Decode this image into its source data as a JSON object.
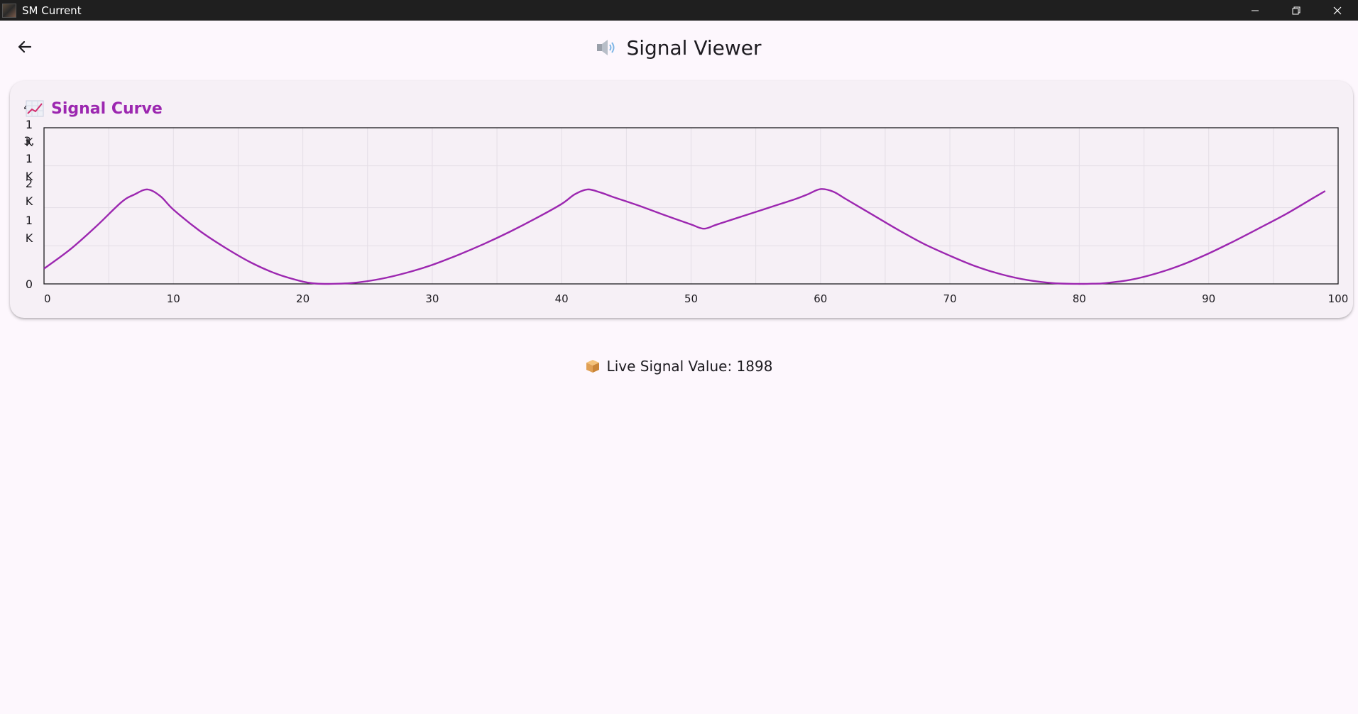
{
  "window": {
    "title": "SM Current",
    "controls": {
      "minimize": "—",
      "restore": "❐",
      "close": "✕"
    }
  },
  "appbar": {
    "back_icon": "arrow-left-icon",
    "title_icon": "speaker-icon",
    "title": "Signal Viewer"
  },
  "card": {
    "icon": "chart-increasing-icon",
    "title": "Signal Curve"
  },
  "live": {
    "icon": "package-icon",
    "text": "Live Signal Value: 1898"
  },
  "colors": {
    "accent": "#9c27b0",
    "background": "#fdf7fd",
    "card": "#f6f0f6",
    "titlebar": "#1f1f1f"
  },
  "chart_data": {
    "type": "line",
    "title": "",
    "xlabel": "",
    "ylabel": "",
    "xlim": [
      0,
      100
    ],
    "ylim": [
      0,
      4100
    ],
    "grid": true,
    "y_tick_labels": [
      "4.1K",
      "3.1K",
      "2K",
      "1K",
      "0"
    ],
    "y_tick_values": [
      4100,
      3100,
      2000,
      1000,
      0
    ],
    "x_tick_labels": [
      "0",
      "10",
      "20",
      "30",
      "40",
      "50",
      "60",
      "70",
      "80",
      "90",
      "100"
    ],
    "x_tick_values": [
      0,
      10,
      20,
      30,
      40,
      50,
      60,
      70,
      80,
      90,
      100
    ],
    "series": [
      {
        "color": "#9c27b0",
        "x": [
          0,
          2,
          4,
          6,
          7,
          8,
          9,
          10,
          12,
          14,
          16,
          18,
          20,
          21,
          22,
          24,
          26,
          28,
          30,
          32,
          34,
          36,
          38,
          40,
          41,
          42,
          43,
          44,
          46,
          48,
          50,
          51,
          52,
          54,
          56,
          58,
          59,
          60,
          61,
          62,
          64,
          66,
          68,
          70,
          72,
          74,
          76,
          78,
          80,
          81,
          82,
          84,
          86,
          88,
          90,
          92,
          94,
          96,
          98,
          99
        ],
        "y": [
          400,
          900,
          1500,
          2150,
          2350,
          2480,
          2300,
          1950,
          1400,
          950,
          560,
          260,
          60,
          10,
          0,
          30,
          130,
          290,
          500,
          760,
          1050,
          1370,
          1720,
          2100,
          2350,
          2480,
          2400,
          2280,
          2050,
          1800,
          1560,
          1450,
          1560,
          1780,
          2000,
          2220,
          2350,
          2490,
          2420,
          2220,
          1820,
          1420,
          1050,
          740,
          460,
          250,
          100,
          20,
          0,
          5,
          20,
          110,
          280,
          510,
          800,
          1130,
          1480,
          1840,
          2240,
          2440
        ]
      }
    ]
  }
}
